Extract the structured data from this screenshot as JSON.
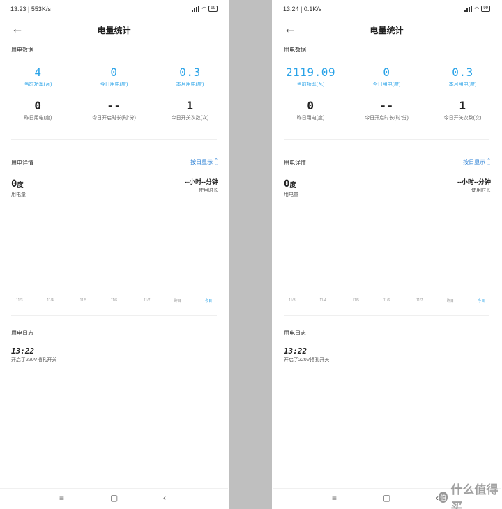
{
  "left": {
    "status": {
      "time": "13:23",
      "speed": "553K/s",
      "battery": "99"
    },
    "header": {
      "title": "电量统计"
    },
    "section_data": "用电数据",
    "stats": [
      {
        "value": "4",
        "label": "当前功率(瓦)"
      },
      {
        "value": "0",
        "label": "今日用电(度)"
      },
      {
        "value": "0.3",
        "label": "本月用电(度)"
      },
      {
        "value": "0",
        "label": "昨日用电(度)"
      },
      {
        "value": "--",
        "label": "今日开启时长(时:分)"
      },
      {
        "value": "1",
        "label": "今日开关次数(次)"
      }
    ],
    "section_detail": "用电详情",
    "sort_label": "按日显示",
    "usage": {
      "value": "0",
      "unit": "度",
      "label": "用电量"
    },
    "duration": {
      "value": "--小时--分钟",
      "label": "使用时长"
    },
    "axis": [
      "11/3",
      "11/4",
      "11/5",
      "11/6",
      "11/7",
      "昨日",
      "今日"
    ],
    "section_log": "用电日志",
    "log": {
      "time": "13:22",
      "desc": "开启了220V插孔开关"
    }
  },
  "right": {
    "status": {
      "time": "13:24",
      "speed": "0.1K/s",
      "battery": "99"
    },
    "header": {
      "title": "电量统计"
    },
    "section_data": "用电数据",
    "stats": [
      {
        "value": "2119.09",
        "label": "当前功率(瓦)"
      },
      {
        "value": "0",
        "label": "今日用电(度)"
      },
      {
        "value": "0.3",
        "label": "本月用电(度)"
      },
      {
        "value": "0",
        "label": "昨日用电(度)"
      },
      {
        "value": "--",
        "label": "今日开启时长(时:分)"
      },
      {
        "value": "1",
        "label": "今日开关次数(次)"
      }
    ],
    "section_detail": "用电详情",
    "sort_label": "按日显示",
    "usage": {
      "value": "0",
      "unit": "度",
      "label": "用电量"
    },
    "duration": {
      "value": "--小时--分钟",
      "label": "使用时长"
    },
    "axis": [
      "11/3",
      "11/4",
      "11/5",
      "11/6",
      "11/7",
      "昨日",
      "今日"
    ],
    "section_log": "用电日志",
    "log": {
      "time": "13:22",
      "desc": "开启了220V插孔开关"
    }
  },
  "watermark": {
    "badge": "值",
    "text": "什么值得买"
  },
  "icons": {
    "back": "arrow-left-icon",
    "sort": "chevron-up-down-icon",
    "nav_menu": "menu-icon",
    "nav_home": "home-icon",
    "nav_back": "nav-back-icon"
  },
  "colors": {
    "accent": "#2aa3e8",
    "link": "#2a7fd4",
    "divider": "#bfbfbf"
  }
}
